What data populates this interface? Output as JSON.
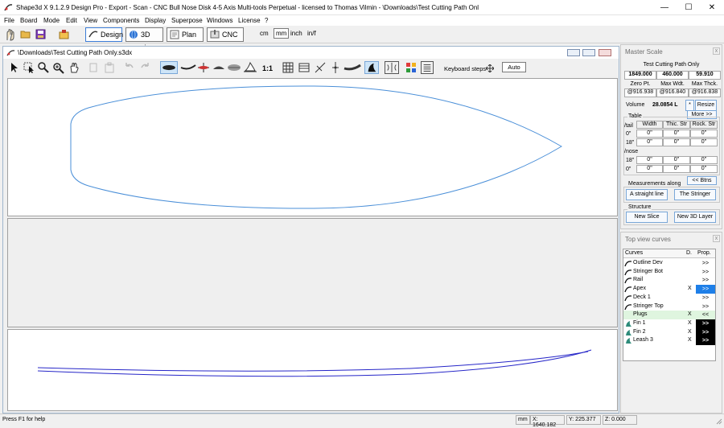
{
  "window": {
    "title": "Shape3d X 9.1.2.9 Design Pro - Export - Scan - CNC Bull Nose Disk 4-5 Axis Multi-tools Perpetual - licensed to Thomas Vilmin - \\Downloads\\Test Cutting Path Onl",
    "minimize": "—",
    "maximize": "☐",
    "close": "✕"
  },
  "menu": [
    "File",
    "Board",
    "Mode",
    "Edit",
    "View",
    "Components",
    "Display",
    "Superpose",
    "Windows",
    "License",
    "?"
  ],
  "toolbar": {
    "design": "Design",
    "view3d": "3D view",
    "plan": "Plan",
    "cnc": "CNC",
    "units": [
      "cm",
      "mm",
      "inch",
      "in/f"
    ],
    "selected_unit": "mm"
  },
  "document": {
    "title": "\\Downloads\\Test Cutting Path Only.s3dx",
    "scale_label": "1:1",
    "keyboard_steps_label": "Keyboard steps",
    "auto_label": "Auto"
  },
  "master_scale": {
    "title": "Master Scale",
    "board_name": "Test Cutting Path Only",
    "values": [
      "1849.000",
      "460.000",
      "59.910"
    ],
    "labels": [
      "Zero Pt.",
      "Max Wdt.",
      "Max Thck."
    ],
    "positions": [
      "@916.938",
      "@916.840",
      "@916.838"
    ],
    "volume_label": "Volume",
    "volume_value": "28.0854 L",
    "star_btn": "*",
    "resize_btn": "Resize",
    "more_btn": "More >>",
    "table_label": "Table",
    "table_headers": [
      "Width",
      "Thic. Str",
      "Rock. Str"
    ],
    "tail_label": "/tail",
    "nose_label": "/nose",
    "row_labels": [
      "0\"",
      "18\"",
      "18\"",
      "0\""
    ],
    "row_cells": [
      [
        "0\"",
        "0\"",
        "0\""
      ],
      [
        "0\"",
        "0\"",
        "0\""
      ],
      [
        "0\"",
        "0\"",
        "0\""
      ],
      [
        "0\"",
        "0\"",
        "0\""
      ]
    ],
    "btns_btn": "<< Btns",
    "measurements_label": "Measurements along",
    "straight_btn": "A straight line",
    "stringer_btn": "The Stringer",
    "structure_label": "Structure",
    "new_slice_btn": "New Slice",
    "new_layer_btn": "New 3D Layer"
  },
  "curves_panel": {
    "title": "Top view curves",
    "headers": [
      "Curves",
      "D.",
      "Prop."
    ],
    "rows": [
      {
        "name": "Outline Dev",
        "d": "",
        "prop": ">>",
        "style": "plain"
      },
      {
        "name": "Stringer Bot",
        "d": "",
        "prop": ">>",
        "style": "plain"
      },
      {
        "name": "Rail",
        "d": "",
        "prop": ">>",
        "style": "plain"
      },
      {
        "name": "Apex",
        "d": "X",
        "prop": ">>",
        "style": "blue"
      },
      {
        "name": "Deck 1",
        "d": "",
        "prop": ">>",
        "style": "plain"
      },
      {
        "name": "Stringer Top",
        "d": "",
        "prop": ">>",
        "style": "plain"
      },
      {
        "name": "Plugs",
        "d": "X",
        "prop": "<<",
        "style": "green"
      },
      {
        "name": "Fin 1",
        "d": "X",
        "prop": ">>",
        "style": "black"
      },
      {
        "name": "Fin 2",
        "d": "X",
        "prop": ">>",
        "style": "black"
      },
      {
        "name": "Leash 3",
        "d": "X",
        "prop": ">>",
        "style": "black"
      }
    ]
  },
  "status": {
    "help": "Press F1 for help",
    "unit": "mm",
    "x": "X: 1640.182",
    "y": "Y: 225.377",
    "z": "Z: 0.000"
  },
  "colors": {
    "outline_curve": "#4a8fd8",
    "profile_curve": "#2626c8",
    "blue_prop": "#1e7fe8",
    "green_row": "#dff5df"
  }
}
